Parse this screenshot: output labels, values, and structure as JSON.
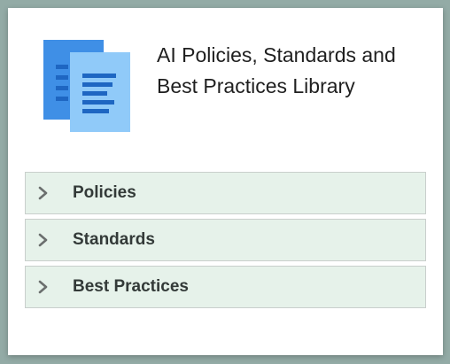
{
  "title": {
    "text": "AI Policies, Standards and Best Practices Library"
  },
  "colors": {
    "background": "#93aba6",
    "card": "#ffffff",
    "accordion_bg": "#e6f2ea",
    "icon_back": "#3f8fe6",
    "icon_front": "#90caf9",
    "icon_lines": "#1e66c2"
  },
  "header": {
    "icon_name": "documents-icon"
  },
  "accordion": {
    "items": [
      {
        "label": "Policies",
        "icon": "chevron-right-icon",
        "expanded": false
      },
      {
        "label": "Standards",
        "icon": "chevron-right-icon",
        "expanded": false
      },
      {
        "label": "Best Practices",
        "icon": "chevron-right-icon",
        "expanded": false
      }
    ]
  }
}
